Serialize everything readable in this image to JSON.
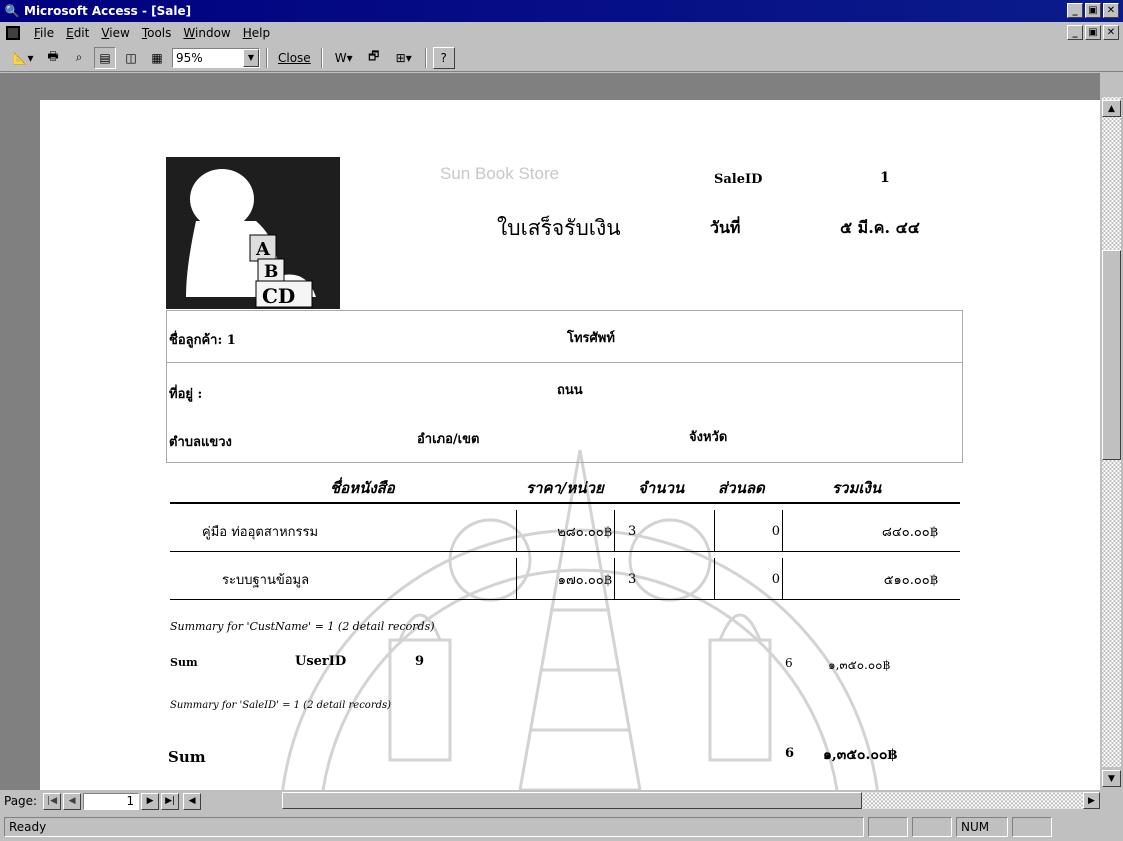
{
  "window": {
    "title": "Microsoft Access - [Sale]"
  },
  "menu": {
    "items": [
      {
        "label": "File"
      },
      {
        "label": "Edit"
      },
      {
        "label": "View"
      },
      {
        "label": "Tools"
      },
      {
        "label": "Window"
      },
      {
        "label": "Help"
      }
    ]
  },
  "toolbar": {
    "zoom_value": "95%",
    "close_label": "Close",
    "icons": [
      "design-view-icon",
      "print-icon",
      "zoom-icon",
      "one-page-icon",
      "two-pages-icon",
      "multiple-pages-icon",
      "office-links-icon",
      "database-window-icon",
      "new-object-icon",
      "help-icon"
    ]
  },
  "report": {
    "store_name": "Sun Book Store",
    "receipt_title": "ใบเสร็จรับเงิน",
    "sale_id_label": "SaleID",
    "sale_id_value": "1",
    "date_label": "วันที่",
    "date_value": "๕ มี.ค. ๔๔",
    "logo_blocks": [
      "A",
      "B",
      "CD"
    ],
    "customer": {
      "name_label": "ชื่อลูกค้า: 1",
      "phone_label": "โทรศัพท์",
      "address_label": "ที่อยู่ :",
      "street_label": "ถนน",
      "subdistrict_label": "ตำบลแขวง",
      "district_label": "อำเภอ/เขต",
      "province_label": "จังหวัด"
    },
    "columns": [
      "ชื่อหนังสือ",
      "ราคา/หน่วย",
      "จำนวน",
      "ส่วนลด",
      "รวมเงิน"
    ],
    "items": [
      {
        "title": "คู่มือ ท่ออุตสาหกรรม",
        "price": "๒๘๐.๐๐฿",
        "qty": "3",
        "discount": "0",
        "total": "๘๔๐.๐๐฿"
      },
      {
        "title": "ระบบฐานข้อมูล",
        "price": "๑๗๐.๐๐฿",
        "qty": "3",
        "discount": "0",
        "total": "๕๑๐.๐๐฿"
      }
    ],
    "summary_cust_caption": "Summary for 'CustName' =  1 (2 detail records)",
    "sum_label": "Sum",
    "userid_label": "UserID",
    "userid_value": "9",
    "sum_qty": "6",
    "sum_total": "๑,๓๕๐.๐๐฿",
    "summary_sale_caption": "Summary for 'SaleID' =  1 (2 detail records)",
    "grand_sum_label": "Sum",
    "grand_qty": "6",
    "grand_total": "๑,๓๕๐.๐๐฿"
  },
  "navigation": {
    "page_label": "Page:",
    "page_number": "1"
  },
  "status": {
    "text": "Ready",
    "num_indicator": "NUM"
  }
}
